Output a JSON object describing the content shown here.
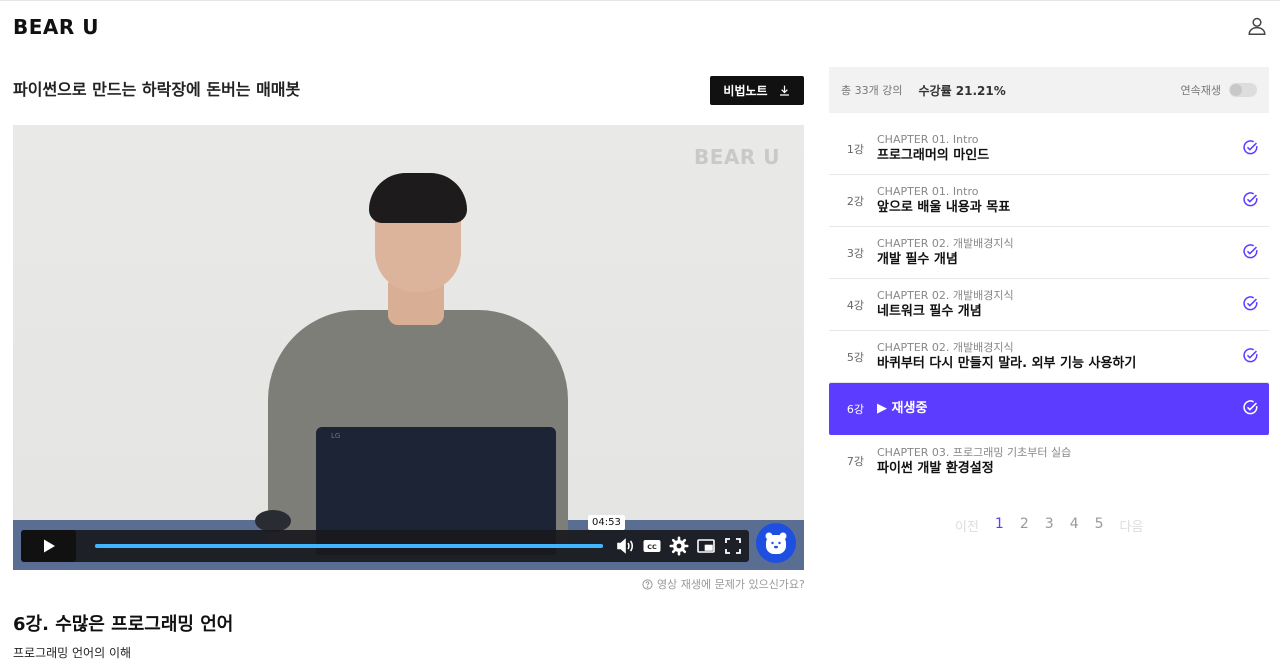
{
  "header": {
    "logo": "BEAR U"
  },
  "course": {
    "title": "파이썬으로 만드는 하락장에 돈버는 매매봇",
    "note_button": "비법노트"
  },
  "video": {
    "watermark": "BEAR U",
    "laptop_logo": "LG",
    "tooltip_time": "04:53",
    "progress_fraction": 1.0,
    "report_link": "영상 재생에 문제가 있으신가요?"
  },
  "lesson": {
    "heading": "6강. 수많은 프로그래밍 언어",
    "subtitle": "프로그래밍 언어의 이해"
  },
  "panel": {
    "total": "총 33개 강의",
    "rate": "수강률 21.21%",
    "autoplay_label": "연속재생",
    "lessons": [
      {
        "num": "1강",
        "chapter": "CHAPTER 01. Intro",
        "title": "프로그래머의 마인드",
        "active": false
      },
      {
        "num": "2강",
        "chapter": "CHAPTER 01. Intro",
        "title": "앞으로 배울 내용과 목표",
        "active": false
      },
      {
        "num": "3강",
        "chapter": "CHAPTER 02. 개발배경지식",
        "title": "개발 필수 개념",
        "active": false
      },
      {
        "num": "4강",
        "chapter": "CHAPTER 02. 개발배경지식",
        "title": "네트워크 필수 개념",
        "active": false
      },
      {
        "num": "5강",
        "chapter": "CHAPTER 02. 개발배경지식",
        "title": "바퀴부터 다시 만들지 말라. 외부 기능 사용하기",
        "active": false
      },
      {
        "num": "6강",
        "chapter": "",
        "title": "▶  재생중",
        "active": true
      },
      {
        "num": "7강",
        "chapter": "CHAPTER 03. 프로그래밍 기초부터 실습",
        "title": "파이썬 개발 환경설정",
        "active": false
      }
    ],
    "pager": {
      "prev": "이전",
      "pages": [
        "1",
        "2",
        "3",
        "4",
        "5"
      ],
      "current": "1",
      "next": "다음"
    }
  },
  "colors": {
    "accent": "#5c3cff",
    "check": "#5c3cff",
    "seek": "#41b6ff"
  }
}
